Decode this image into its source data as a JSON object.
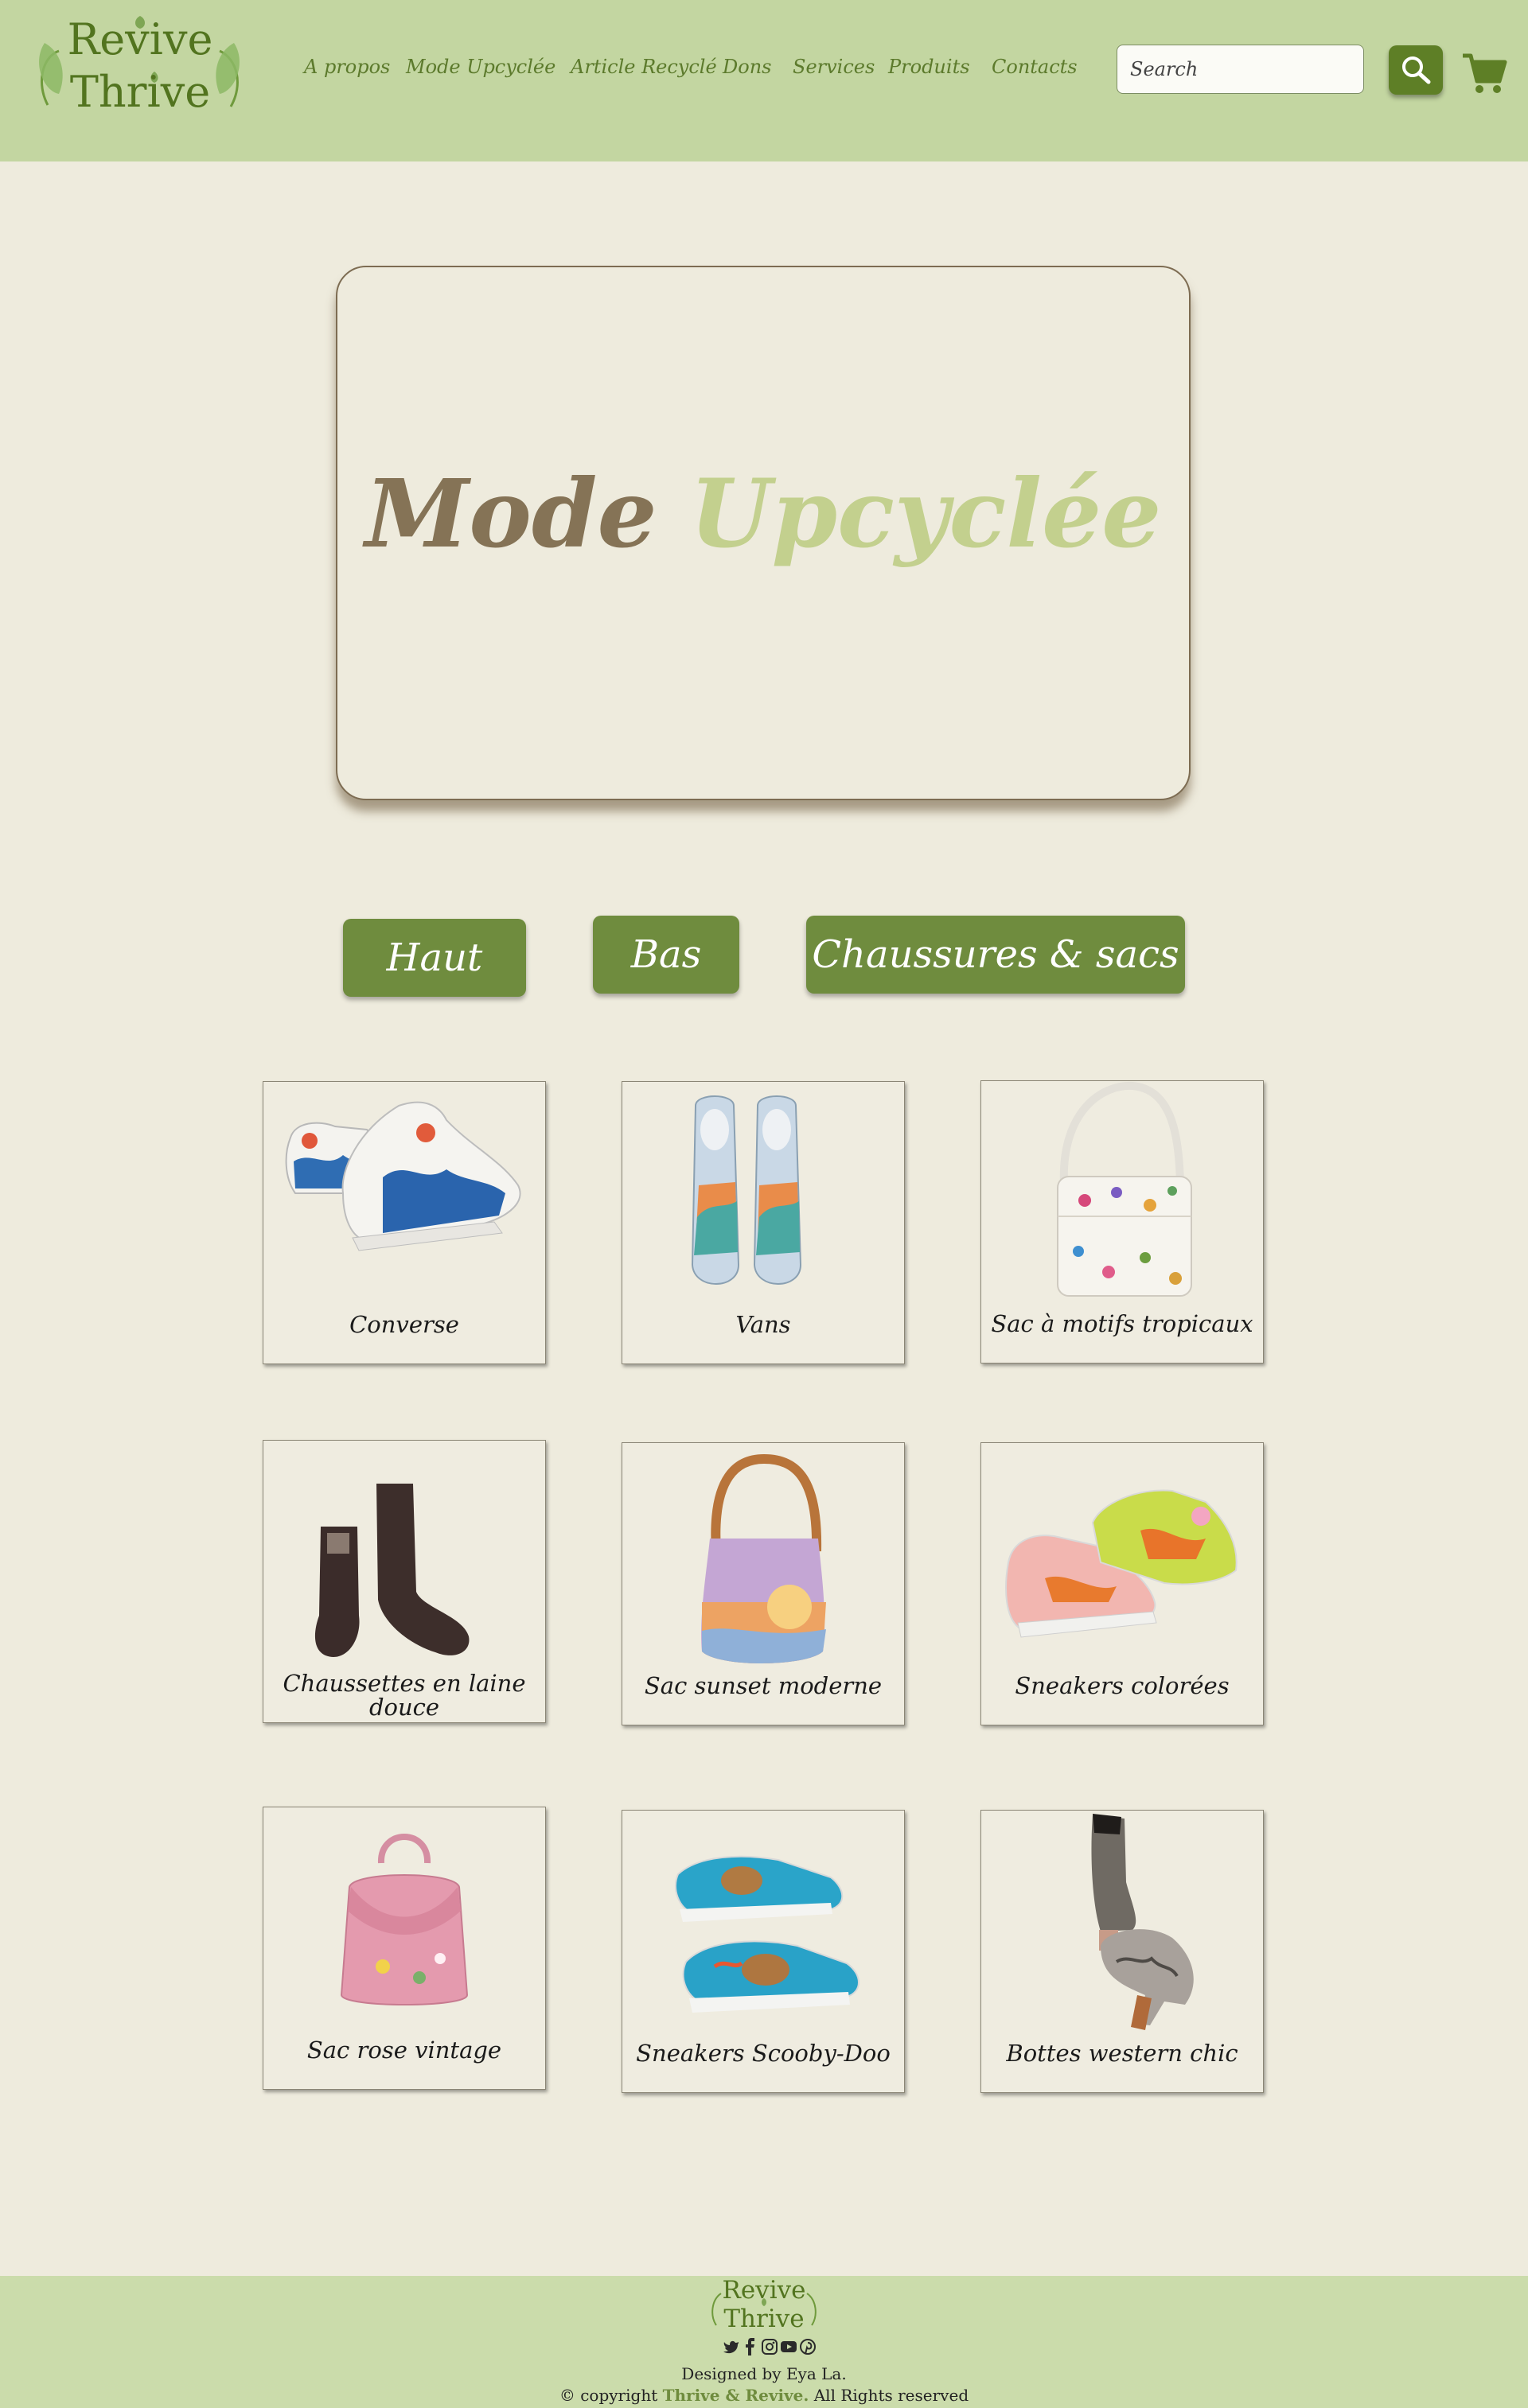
{
  "brand": {
    "line1": "Revive",
    "line2": "Thrive",
    "accent": "#52741f"
  },
  "nav": [
    {
      "label": "A propos"
    },
    {
      "label": "Mode Upcyclée"
    },
    {
      "label": "Article Recyclé"
    },
    {
      "label": "Dons"
    },
    {
      "label": "Services"
    },
    {
      "label": "Produits"
    },
    {
      "label": "Contacts"
    }
  ],
  "search": {
    "placeholder": "Search",
    "button_icon": "search-icon"
  },
  "cart": {
    "icon": "cart-icon"
  },
  "hero": {
    "title_part1": "Mode",
    "title_part2": "Upcyclée",
    "color_part1": "#857356",
    "color_part2": "#c3d08e"
  },
  "categories": [
    {
      "label": "Haut"
    },
    {
      "label": "Bas"
    },
    {
      "label": "Chaussures & sacs"
    }
  ],
  "products": [
    {
      "name": "Converse",
      "image": "painted-wave-high-top-sneakers"
    },
    {
      "name": "Vans",
      "image": "painted-landscape-slip-on-sneakers"
    },
    {
      "name": "Sac à motifs tropicaux",
      "image": "white-floral-shoulder-bag"
    },
    {
      "name": "Chaussettes en laine douce",
      "image": "brown-wool-socks"
    },
    {
      "name": "Sac sunset moderne",
      "image": "sunset-painted-handbag"
    },
    {
      "name": "Sneakers colorées",
      "image": "colorful-painted-high-top-sneakers"
    },
    {
      "name": "Sac rose vintage",
      "image": "pink-bird-embroidered-handbag"
    },
    {
      "name": "Sneakers Scooby-Doo",
      "image": "scooby-doo-painted-sneakers"
    },
    {
      "name": "Bottes western chic",
      "image": "painted-western-ankle-boots"
    }
  ],
  "footer": {
    "logo_line1": "Revive",
    "logo_line2": "Thrive",
    "socials": [
      "twitter-icon",
      "facebook-icon",
      "instagram-icon",
      "youtube-icon",
      "pinterest-icon"
    ],
    "designed_prefix": "Designed by",
    "designer": "Eya La.",
    "copyright_prefix": "© copyright",
    "copyright_brand": "Thrive & Revive.",
    "copyright_suffix": "All Rights reserved"
  }
}
